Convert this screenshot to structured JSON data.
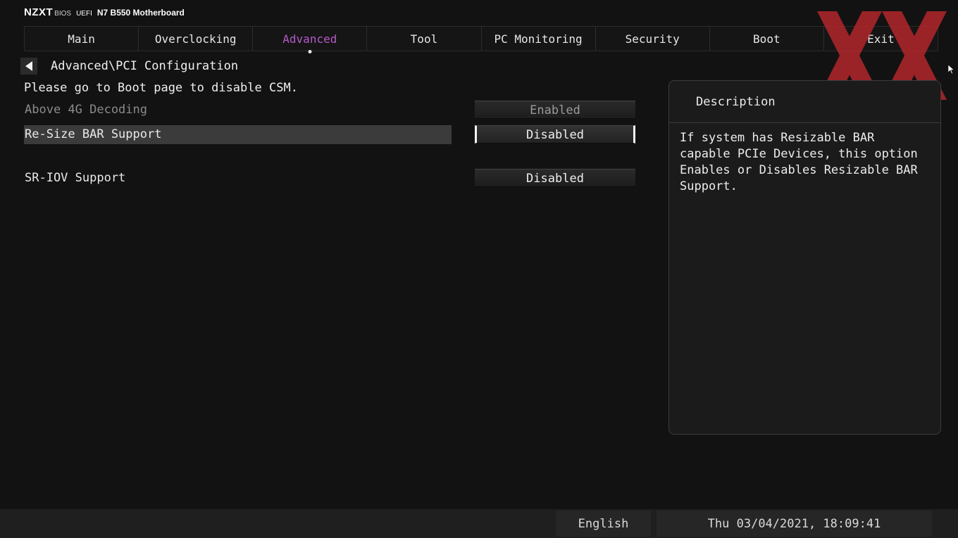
{
  "brand": {
    "name": "NZXT",
    "bios": "BIOS",
    "uefi": "UEFI",
    "model": "N7 B550 Motherboard"
  },
  "tabs": [
    {
      "label": "Main"
    },
    {
      "label": "Overclocking"
    },
    {
      "label": "Advanced",
      "active": true
    },
    {
      "label": "Tool"
    },
    {
      "label": "PC Monitoring"
    },
    {
      "label": "Security"
    },
    {
      "label": "Boot"
    },
    {
      "label": "Exit"
    }
  ],
  "breadcrumb": "Advanced\\PCI Configuration",
  "notice": "Please go to Boot page to disable CSM.",
  "settings": [
    {
      "label": "Above 4G Decoding",
      "value": "Enabled",
      "state": "disabled"
    },
    {
      "label": "Re-Size BAR Support",
      "value": "Disabled",
      "state": "selected"
    },
    {
      "label": "SR-IOV Support",
      "value": "Disabled",
      "state": "normal"
    }
  ],
  "description": {
    "title": "Description",
    "text": "If system has Resizable BAR capable PCIe Devices, this option Enables or Disables Resizable BAR Support."
  },
  "status": {
    "language": "English",
    "datetime": "Thu 03/04/2021, 18:09:41"
  },
  "colors": {
    "accent": "#b45ac8",
    "watermark": "#c0282d",
    "background": "#121212"
  },
  "icons": {
    "back": "back-arrow-icon",
    "watermark": "xx-watermark-icon",
    "cursor": "mouse-pointer-icon"
  }
}
